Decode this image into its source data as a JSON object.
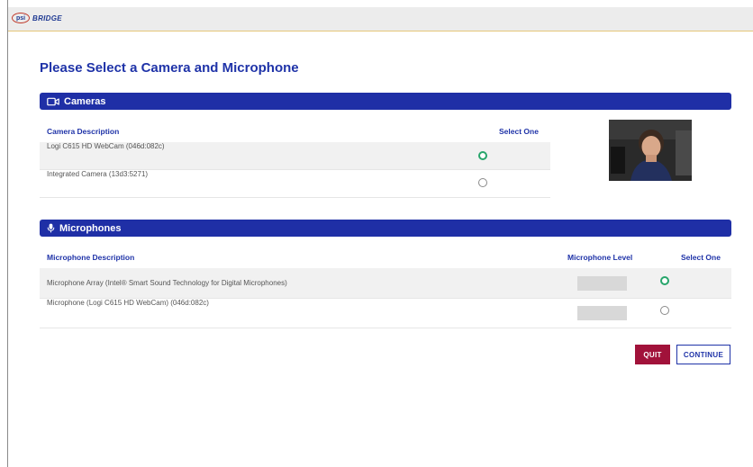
{
  "app": {
    "logo_mark": "psi",
    "logo_word": "BRIDGE"
  },
  "page": {
    "title": "Please Select a Camera and Microphone"
  },
  "cameras": {
    "section_title": "Cameras",
    "icon": "video-camera-icon",
    "columns": {
      "description": "Camera Description",
      "select": "Select One"
    },
    "items": [
      {
        "label": "Logi C615 HD WebCam (046d:082c)",
        "selected": true
      },
      {
        "label": "Integrated Camera (13d3:5271)",
        "selected": false
      }
    ]
  },
  "microphones": {
    "section_title": "Microphones",
    "icon": "microphone-icon",
    "columns": {
      "description": "Microphone Description",
      "level": "Microphone Level",
      "select": "Select One"
    },
    "items": [
      {
        "label": "Microphone Array (Intel® Smart Sound Technology for Digital Microphones)",
        "selected": true,
        "level": 0
      },
      {
        "label": "Microphone (Logi C615 HD WebCam) (046d:082c)",
        "selected": false,
        "level": 0
      }
    ]
  },
  "actions": {
    "quit_label": "QUIT",
    "continue_label": "CONTINUE"
  },
  "colors": {
    "brand_blue": "#1f2fa6",
    "quit_red": "#a1123a",
    "selected_green": "#27a56b"
  }
}
